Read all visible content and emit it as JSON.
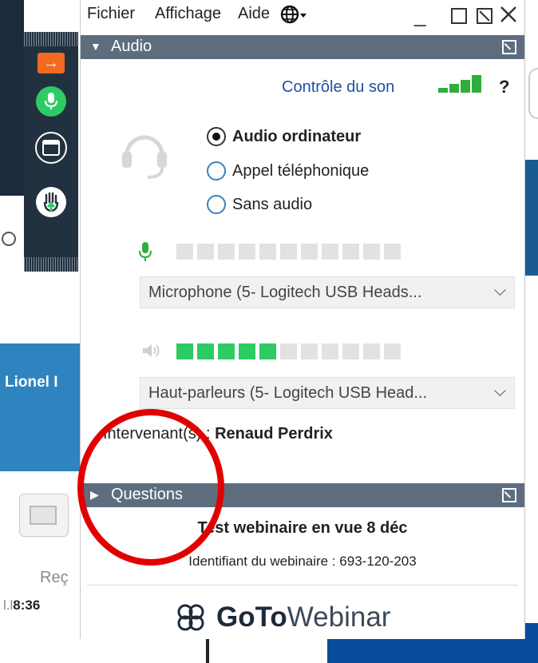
{
  "background": {
    "name_fragment": "Lionel I",
    "rec_fragment": "Reç",
    "time_prefix": "l.l",
    "time": "8:36"
  },
  "menu": {
    "file": "Fichier",
    "view": "Affichage",
    "help": "Aide"
  },
  "audio": {
    "header": "Audio",
    "sound_check": "Contrôle du son",
    "help_symbol": "?",
    "options": [
      {
        "label": "Audio ordinateur",
        "selected": true
      },
      {
        "label": "Appel téléphonique",
        "selected": false
      },
      {
        "label": "Sans audio",
        "selected": false
      }
    ],
    "microphone": {
      "device": "Microphone (5- Logitech USB Heads...",
      "level": "0 / 11"
    },
    "speakers": {
      "device": "Haut-parleurs (5- Logitech USB Head...",
      "level": "5 / 11"
    },
    "presenter_label": "Intervenant(s) :",
    "presenter_name": "Renaud Perdrix"
  },
  "questions": {
    "header": "Questions"
  },
  "webinar": {
    "title": "Test webinaire en vue 8 déc",
    "id_line": "Identifiant du webinaire : 693-120-203"
  },
  "brand": {
    "goto": "GoTo",
    "webinar": "Webinar"
  },
  "colors": {
    "header_bg": "#5d6d7e",
    "accent_green": "#2ecb64",
    "link_blue": "#1f4fa3",
    "annotation_red": "#e10000",
    "strip_bg": "#22313f",
    "orange": "#f26b21"
  }
}
